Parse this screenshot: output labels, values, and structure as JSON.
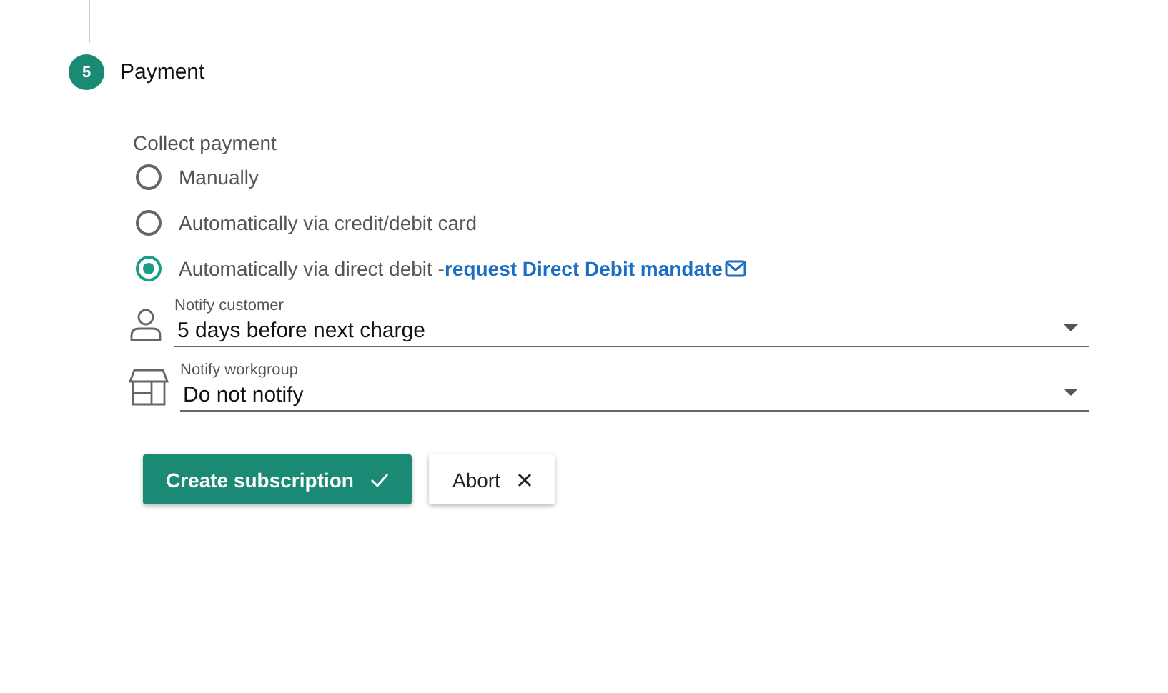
{
  "step": {
    "number": "5",
    "title": "Payment"
  },
  "collect_payment": {
    "label": "Collect payment",
    "options": [
      {
        "label": "Manually",
        "selected": false
      },
      {
        "label": "Automatically via credit/debit card",
        "selected": false
      },
      {
        "label": "Automatically via direct debit -",
        "selected": true,
        "link": "request Direct Debit mandate"
      }
    ]
  },
  "fields": [
    {
      "kind": "person",
      "label": "Notify customer",
      "value": "5 days before next charge"
    },
    {
      "kind": "store",
      "label": "Notify workgroup",
      "value": "Do not notify"
    }
  ],
  "buttons": [
    {
      "kind": "primary",
      "label": "Create subscription"
    },
    {
      "kind": "secondary",
      "label": "Abort"
    }
  ]
}
